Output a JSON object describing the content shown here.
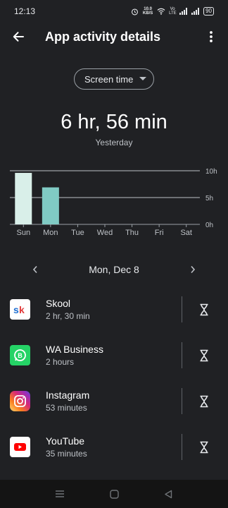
{
  "status_bar": {
    "time": "12:13",
    "data_speed": "10.0 KB/S",
    "network": "Vo LTE",
    "battery": "90"
  },
  "header": {
    "title": "App activity details",
    "back_icon": "arrow-left-icon",
    "menu_icon": "more-vert-icon"
  },
  "filter": {
    "selected": "Screen time"
  },
  "summary": {
    "total": "6 hr, 56 min",
    "label": "Yesterday"
  },
  "chart_data": {
    "type": "bar",
    "categories": [
      "Sun",
      "Mon",
      "Tue",
      "Wed",
      "Thu",
      "Fri",
      "Sat"
    ],
    "values": [
      9.6,
      6.9,
      0,
      0,
      0,
      0,
      0
    ],
    "highlight_index": 1,
    "ylim": [
      0,
      10
    ],
    "y_ticks": [
      "10h",
      "5h",
      "0h"
    ],
    "y_tick_values": [
      10,
      5,
      0
    ],
    "bar_color": "#d9efe9",
    "highlight_color": "#80cbc4",
    "grid": true
  },
  "date_nav": {
    "label": "Mon, Dec 8"
  },
  "apps": [
    {
      "name": "Skool",
      "usage": "2 hr, 30 min",
      "icon": "skool-icon",
      "icon_text": "sk",
      "color": "#ffffff"
    },
    {
      "name": "WA Business",
      "usage": "2 hours",
      "icon": "whatsapp-business-icon",
      "icon_text": "",
      "color": "#25d366"
    },
    {
      "name": "Instagram",
      "usage": "53 minutes",
      "icon": "instagram-icon",
      "icon_text": "",
      "color": "#d6249f"
    },
    {
      "name": "YouTube",
      "usage": "35 minutes",
      "icon": "youtube-icon",
      "icon_text": "",
      "color": "#ffffff"
    }
  ],
  "nav_bar": {
    "recents_icon": "menu-lines-icon",
    "home_icon": "home-square-icon",
    "back_icon": "back-triangle-icon"
  }
}
